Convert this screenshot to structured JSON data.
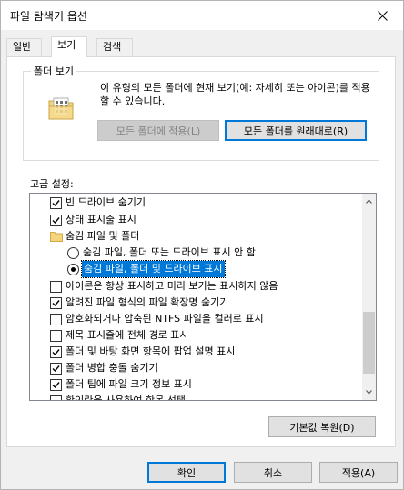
{
  "window": {
    "title": "파일 탐색기 옵션"
  },
  "tabs": [
    {
      "label": "일반"
    },
    {
      "label": "보기"
    },
    {
      "label": "검색"
    }
  ],
  "folder_views": {
    "legend": "폴더 보기",
    "description": "이 유형의 모든 폴더에 현재 보기(예: 자세히 또는 아이콘)를 적용할 수 있습니다.",
    "apply_button": "모든 폴더에 적용(L)",
    "reset_button": "모든 폴더를 원래대로(R)"
  },
  "advanced": {
    "label": "고급 설정:",
    "items": [
      {
        "type": "checkbox",
        "checked": true,
        "label": "빈 드라이브 숨기기"
      },
      {
        "type": "checkbox",
        "checked": true,
        "label": "상태 표시줄 표시"
      },
      {
        "type": "folder",
        "label": "숨김 파일 및 폴더"
      },
      {
        "type": "radio",
        "checked": false,
        "label": "숨김 파일, 폴더 또는 드라이브 표시 안 함"
      },
      {
        "type": "radio",
        "checked": true,
        "label": "숨김 파일, 폴더 및 드라이브 표시"
      },
      {
        "type": "checkbox",
        "checked": false,
        "label": "아이콘은 항상 표시하고 미리 보기는 표시하지 않음"
      },
      {
        "type": "checkbox",
        "checked": true,
        "label": "알려진 파일 형식의 파일 확장명 숨기기"
      },
      {
        "type": "checkbox",
        "checked": false,
        "label": "암호화되거나 압축된 NTFS 파일을 컬러로 표시"
      },
      {
        "type": "checkbox",
        "checked": false,
        "label": "제목 표시줄에 전체 경로 표시"
      },
      {
        "type": "checkbox",
        "checked": true,
        "label": "폴더 및 바탕 화면 항목에 팝업 설명 표시"
      },
      {
        "type": "checkbox",
        "checked": true,
        "label": "폴더 병합 충돌 숨기기"
      },
      {
        "type": "checkbox",
        "checked": true,
        "label": "폴더 팁에 파일 크기 정보 표시"
      },
      {
        "type": "checkbox",
        "checked": false,
        "label": "확인란을 사용하여 항목 선택"
      }
    ]
  },
  "restore_defaults_button": "기본값 복원(D)",
  "footer": {
    "ok": "확인",
    "cancel": "취소",
    "apply": "적용(A)"
  },
  "colors": {
    "selection": "#0078d7",
    "focus_border": "#0078d7"
  }
}
